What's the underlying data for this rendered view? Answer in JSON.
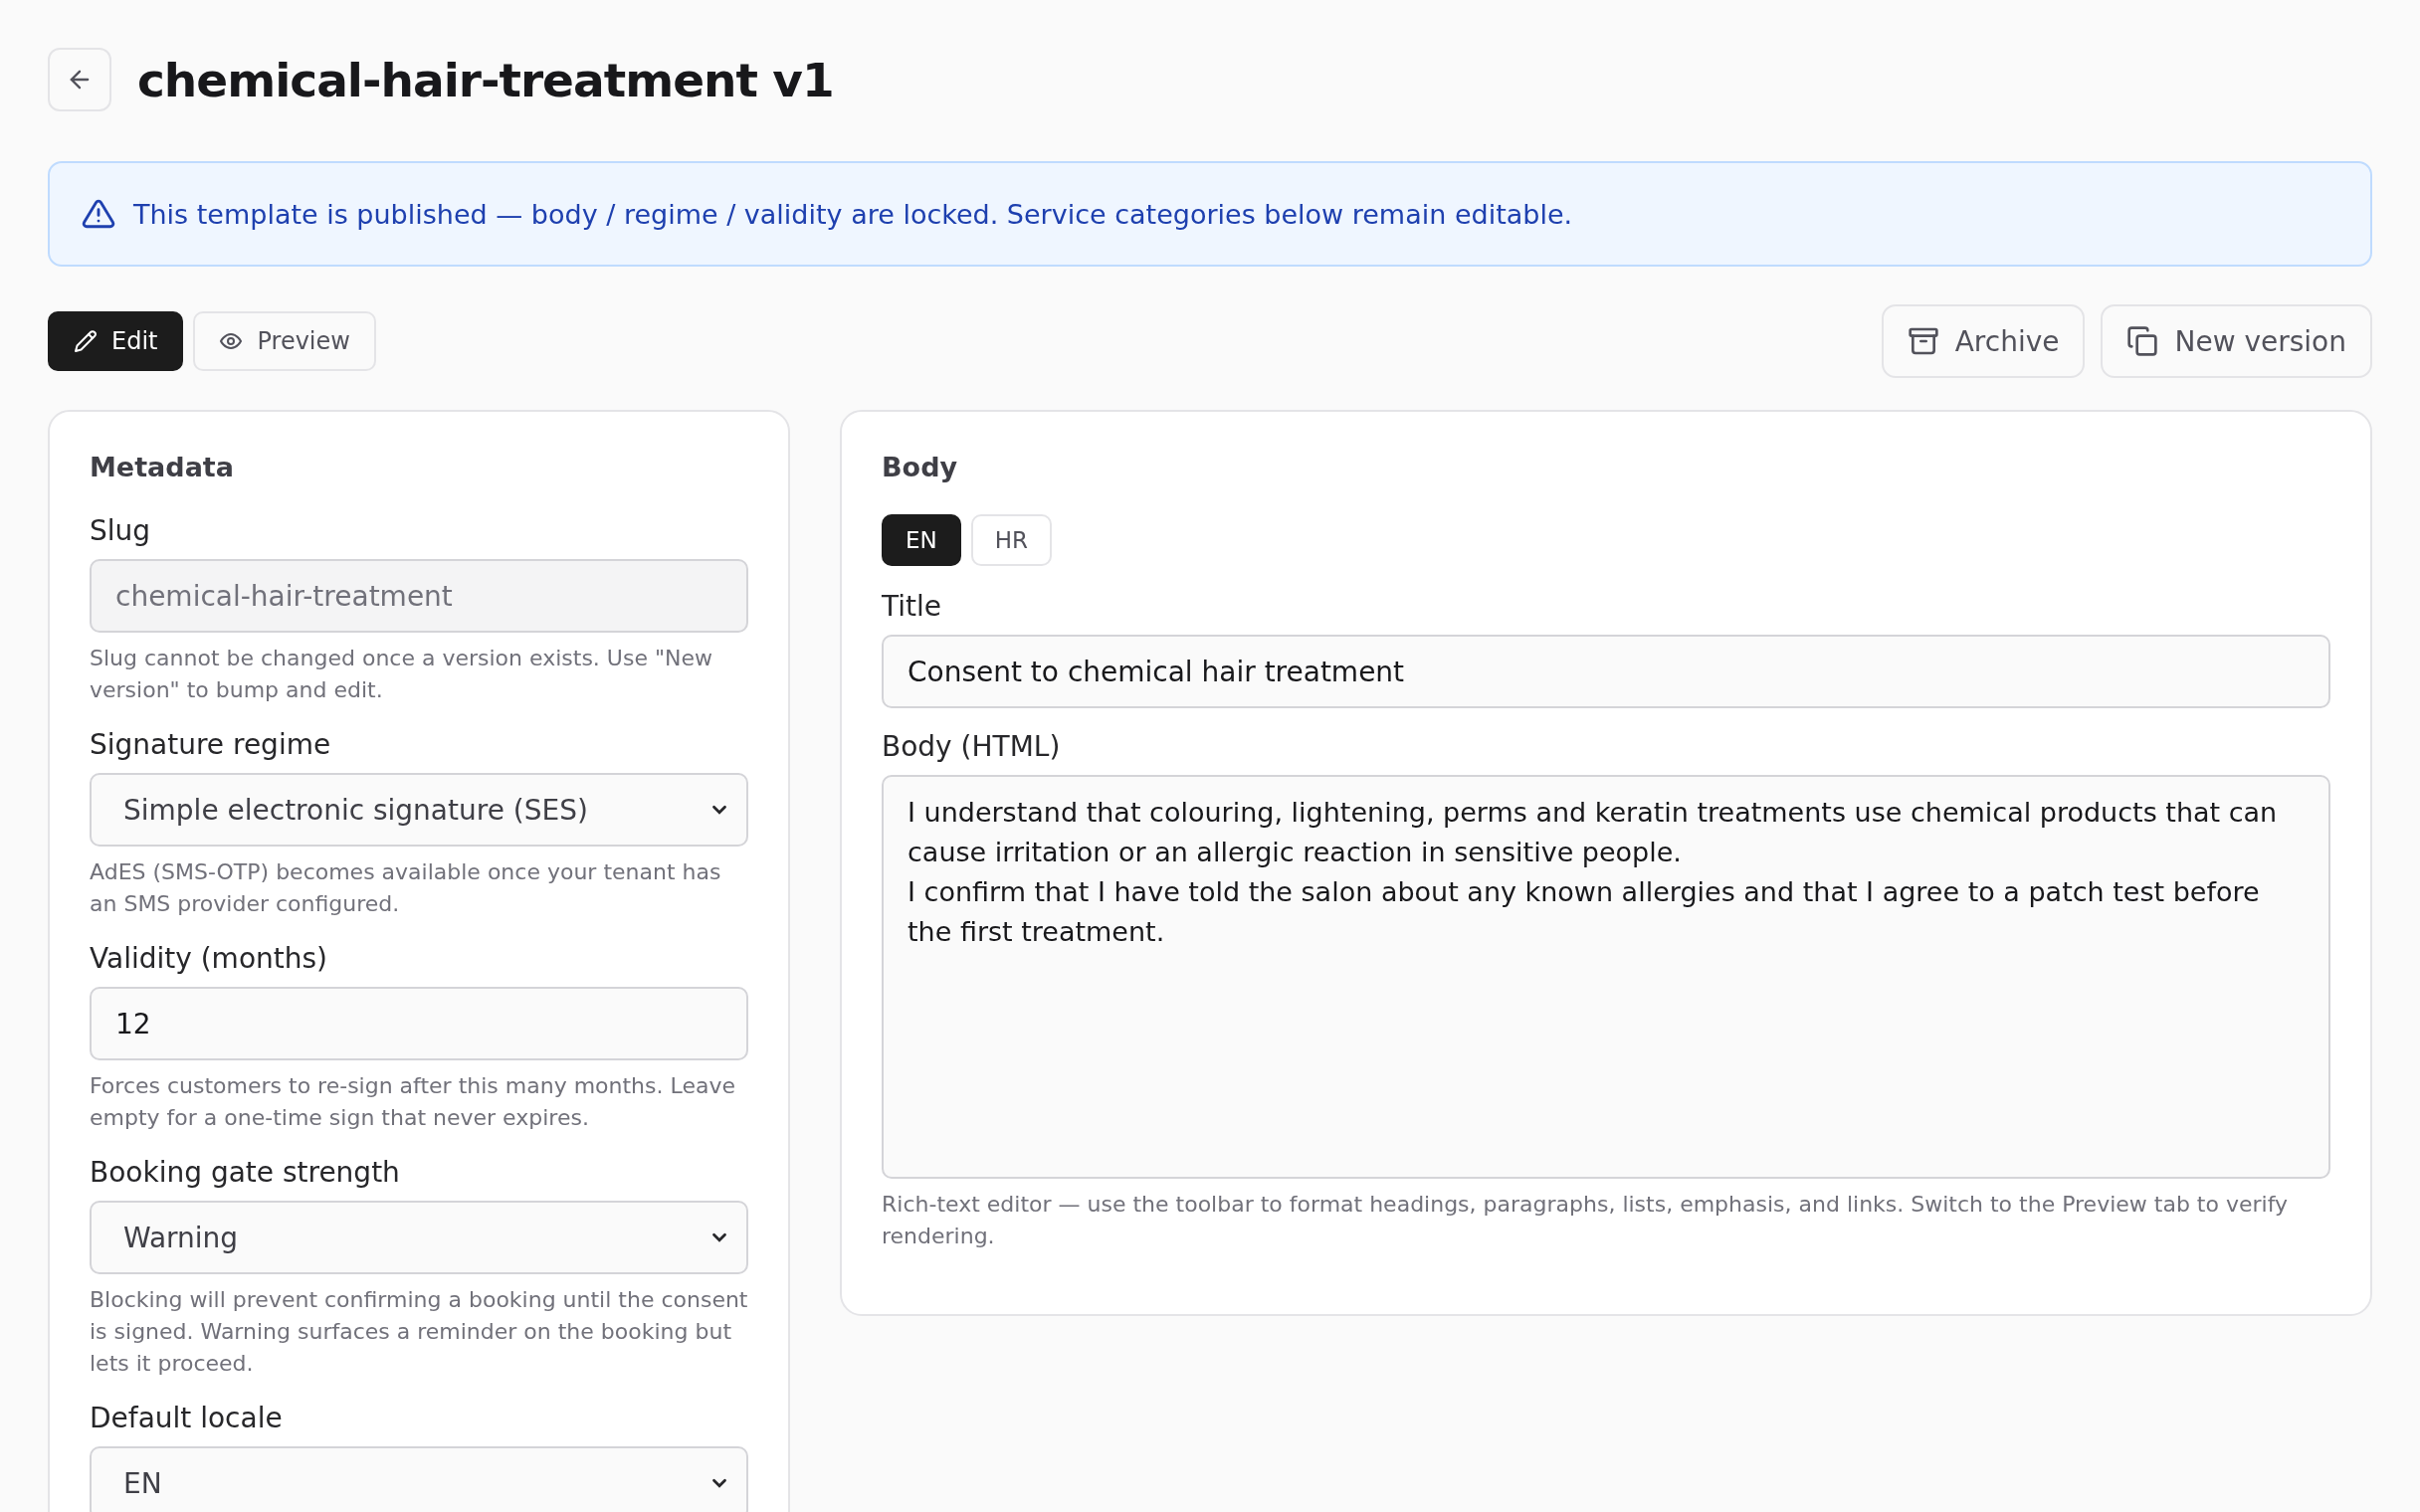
{
  "page": {
    "title": "chemical-hair-treatment v1"
  },
  "notice": {
    "text": "This template is published — body / regime / validity are locked. Service categories below remain editable."
  },
  "mode_tabs": [
    {
      "label": "Edit",
      "selected": true
    },
    {
      "label": "Preview",
      "selected": false
    }
  ],
  "actions": [
    {
      "label": "Archive"
    },
    {
      "label": "New version"
    }
  ],
  "metadata": {
    "heading": "Metadata",
    "fields": [
      {
        "kind": "input",
        "label": "Slug",
        "value": "chemical-hair-treatment",
        "disabled": true,
        "help": "Slug cannot be changed once a version exists. Use \"New version\" to bump and edit."
      },
      {
        "kind": "select",
        "label": "Signature regime",
        "value": "Simple electronic signature (SES)",
        "help": "AdES (SMS-OTP) becomes available once your tenant has an SMS provider configured."
      },
      {
        "kind": "input",
        "label": "Validity (months)",
        "value": "12",
        "disabled": false,
        "help": "Forces customers to re-sign after this many months. Leave empty for a one-time sign that never expires."
      },
      {
        "kind": "select",
        "label": "Booking gate strength",
        "value": "Warning",
        "help": "Blocking will prevent confirming a booking until the consent is signed. Warning surfaces a reminder on the booking but lets it proceed."
      },
      {
        "kind": "select",
        "label": "Default locale",
        "value": "EN"
      }
    ]
  },
  "body": {
    "heading": "Body",
    "locales": [
      {
        "label": "EN",
        "selected": true
      },
      {
        "label": "HR",
        "selected": false
      }
    ],
    "title_label": "Title",
    "title_value": "Consent to chemical hair treatment",
    "body_label": "Body (HTML)",
    "body_lines": [
      "I understand that colouring, lightening, perms and keratin treatments use chemical products that can cause irritation or an allergic reaction in sensitive people.",
      "I confirm that I have told the salon about any known allergies and that I agree to a patch test before the first treatment."
    ],
    "help": "Rich-text editor — use the toolbar to format headings, paragraphs, lists, emphasis, and links. Switch to the Preview tab to verify rendering."
  }
}
